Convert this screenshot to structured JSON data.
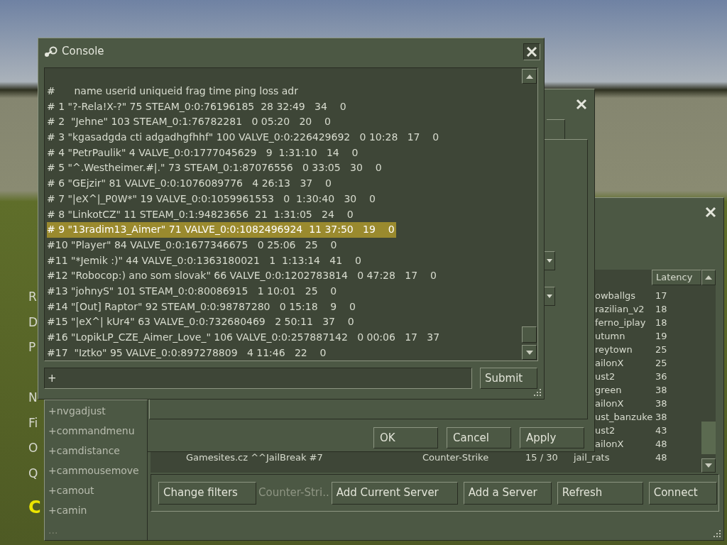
{
  "menu_fragments_top": [
    "R",
    "D",
    "P"
  ],
  "menu_fragments_bottom": [
    "N",
    "Fi",
    "O",
    "Q"
  ],
  "logo_fragment": "C",
  "server_browser": {
    "columns": [
      "Latency"
    ],
    "rows": [
      {
        "map": "owballgs",
        "latency": "17"
      },
      {
        "map": "razilian_v2",
        "latency": "18"
      },
      {
        "map": "ferno_iplay",
        "latency": "18"
      },
      {
        "map": "utumn",
        "latency": "19"
      },
      {
        "map": "reytown",
        "latency": "25"
      },
      {
        "map": "ailonX",
        "latency": "25"
      },
      {
        "map": "ust2",
        "latency": "36"
      },
      {
        "map": "green",
        "latency": "38"
      },
      {
        "map": "ailonX",
        "latency": "38"
      },
      {
        "map": "ust_banzuke",
        "latency": "38"
      },
      {
        "map": "ust2",
        "latency": "43"
      },
      {
        "map": "ailonX",
        "latency": "48"
      },
      {
        "name": "Gamesites.cz ^^JailBreak #7",
        "game": "Counter-Strike",
        "players": "15 / 30",
        "map": "jail_rats",
        "latency": "48"
      }
    ],
    "footer": [
      {
        "kind": "button",
        "label": "Change filters"
      },
      {
        "kind": "label",
        "label": "Counter-Stri.."
      },
      {
        "kind": "button",
        "label": "Add Current Server"
      },
      {
        "kind": "button",
        "label": "Add a Server"
      },
      {
        "kind": "button",
        "label": "Refresh"
      },
      {
        "kind": "button",
        "label": "Connect"
      }
    ]
  },
  "options_dialog": {
    "buttons": [
      "OK",
      "Cancel",
      "Apply"
    ]
  },
  "console": {
    "title": "Console",
    "lines": [
      {
        "text": "#      name userid uniqueid frag time ping loss adr",
        "selected": false
      },
      {
        "text": "# 1 \"?-Rela!X-?\" 75 STEAM_0:0:76196185  28 32:49   34    0",
        "selected": false
      },
      {
        "text": "# 2  \"Jehne\" 103 STEAM_0:1:76782281   0 05:20   20    0",
        "selected": false
      },
      {
        "text": "# 3 \"kgasadgda cti adgadhgfhhf\" 100 VALVE_0:0:226429692   0 10:28   17    0",
        "selected": false
      },
      {
        "text": "# 4 \"PetrPaulik\" 4 VALVE_0:0:1777045629   9  1:31:10   14    0",
        "selected": false
      },
      {
        "text": "# 5 \"^.Westheimer.#|.\" 73 STEAM_0:1:87076556   0 33:05   30    0",
        "selected": false
      },
      {
        "text": "# 6 \"GEjzir\" 81 VALVE_0:0:1076089776   4 26:13   37    0",
        "selected": false
      },
      {
        "text": "# 7 \"|eX^|_P0W*\" 19 VALVE_0:0:1059961553   0  1:30:40   30    0",
        "selected": false
      },
      {
        "text": "# 8 \"LinkotCZ\" 11 STEAM_0:1:94823656  21  1:31:05   24    0",
        "selected": false
      },
      {
        "text": "# 9 \"13radim13_Aimer\" 71 VALVE_0:0:1082496924  11 37:50   19    0",
        "selected": true
      },
      {
        "text": "#10 \"Player\" 84 VALVE_0:0:1677346675   0 25:06   25    0",
        "selected": false
      },
      {
        "text": "#11 \"*Jemik :)\" 44 VALVE_0:0:1363180021   1  1:13:14   41    0",
        "selected": false
      },
      {
        "text": "#12 \"Robocop:) ano som slovak\" 66 VALVE_0:0:1202783814   0 47:28   17    0",
        "selected": false
      },
      {
        "text": "#13 \"johnyS\" 101 STEAM_0:0:80086915   1 10:01   25    0",
        "selected": false
      },
      {
        "text": "#14 \"[Out] Raptor\" 92 STEAM_0:0:98787280   0 15:18    9    0",
        "selected": false
      },
      {
        "text": "#15 \"|eX^| kUr4\" 63 VALVE_0:0:732680469   2 50:11   37    0",
        "selected": false
      },
      {
        "text": "#16 \"LopikLP_CZE_Aimer_Love_\" 106 VALVE_0:0:257887142   0 00:06   17   37",
        "selected": false
      },
      {
        "text": "#17  \"Iztko\" 95 VALVE_0:0:897278809   4 11:46   22    0",
        "selected": false
      }
    ],
    "input": {
      "value": "+"
    },
    "submit": "Submit",
    "suggestions": [
      {
        "kind": "command",
        "text": "+nvgadjust"
      },
      {
        "kind": "command",
        "text": "+commandmenu"
      },
      {
        "kind": "command",
        "text": "+camdistance"
      },
      {
        "kind": "command",
        "text": "+cammousemove"
      },
      {
        "kind": "command",
        "text": "+camout"
      },
      {
        "kind": "command",
        "text": "+camin"
      },
      {
        "kind": "more",
        "text": "..."
      }
    ]
  }
}
